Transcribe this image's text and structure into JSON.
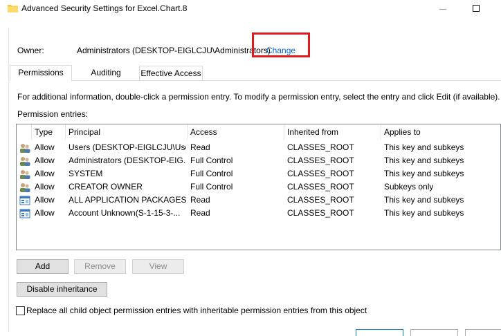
{
  "window": {
    "title": "Advanced Security Settings for Excel.Chart.8",
    "icon": "folder-icon",
    "accent_color": "#0078d7",
    "highlight_color": "#e0191e"
  },
  "owner": {
    "label": "Owner:",
    "value": "Administrators (DESKTOP-EIGLCJU\\Administrators)",
    "change_link": "Change"
  },
  "tabs": [
    {
      "label": "Permissions",
      "active": true
    },
    {
      "label": "Auditing",
      "active": false
    },
    {
      "label": "Effective Access",
      "active": false
    }
  ],
  "permissions": {
    "info_text": "For additional information, double-click a permission entry. To modify a permission entry, select the entry and click Edit (if available).",
    "entries_label": "Permission entries:",
    "columns": [
      "Type",
      "Principal",
      "Access",
      "Inherited from",
      "Applies to"
    ],
    "rows": [
      {
        "icon": "user-group-icon",
        "type": "Allow",
        "principal": "Users (DESKTOP-EIGLCJU\\Use...",
        "access": "Read",
        "inherited": "CLASSES_ROOT",
        "applies": "This key and subkeys"
      },
      {
        "icon": "user-group-icon",
        "type": "Allow",
        "principal": "Administrators (DESKTOP-EIG...",
        "access": "Full Control",
        "inherited": "CLASSES_ROOT",
        "applies": "This key and subkeys"
      },
      {
        "icon": "user-group-icon",
        "type": "Allow",
        "principal": "SYSTEM",
        "access": "Full Control",
        "inherited": "CLASSES_ROOT",
        "applies": "This key and subkeys"
      },
      {
        "icon": "user-group-icon",
        "type": "Allow",
        "principal": "CREATOR OWNER",
        "access": "Full Control",
        "inherited": "CLASSES_ROOT",
        "applies": "Subkeys only"
      },
      {
        "icon": "app-package-icon",
        "type": "Allow",
        "principal": "ALL APPLICATION PACKAGES",
        "access": "Read",
        "inherited": "CLASSES_ROOT",
        "applies": "This key and subkeys"
      },
      {
        "icon": "app-package-icon",
        "type": "Allow",
        "principal": "Account Unknown(S-1-15-3-...",
        "access": "Read",
        "inherited": "CLASSES_ROOT",
        "applies": "This key and subkeys"
      }
    ],
    "buttons": {
      "add": "Add",
      "remove": "Remove",
      "view": "View",
      "disable_inheritance": "Disable inheritance"
    },
    "replace_checkbox": {
      "label": "Replace all child object permission entries with inheritable permission entries from this object",
      "checked": false
    }
  }
}
